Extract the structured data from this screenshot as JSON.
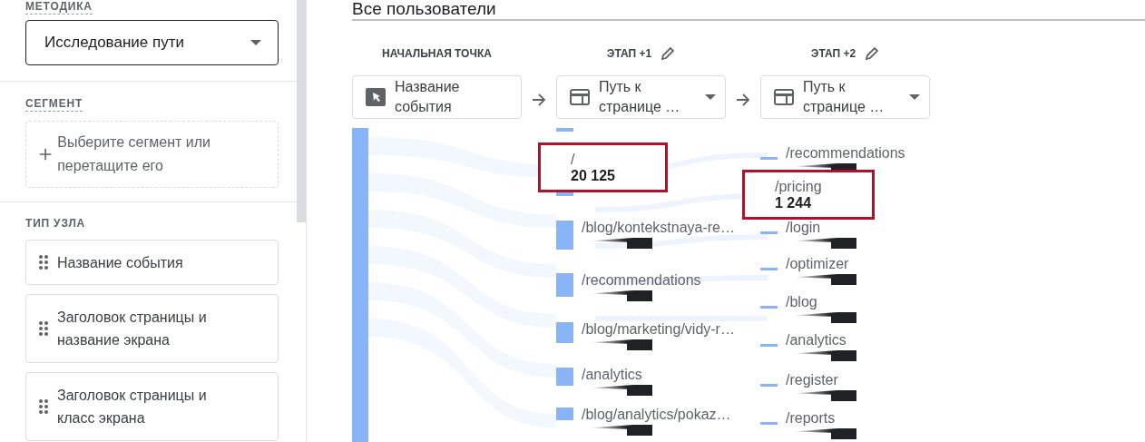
{
  "sidebar": {
    "technique": {
      "label": "МЕТОДИКА",
      "value": "Исследование пути"
    },
    "segment": {
      "label": "СЕГМЕНТ",
      "placeholder": "Выберите сегмент или перетащите его"
    },
    "node_type": {
      "label": "ТИП УЗЛА",
      "items": [
        "Название события",
        "Заголовок страницы и название экрана",
        "Заголовок страницы и класс экрана"
      ]
    }
  },
  "main": {
    "title": "Все пользователи",
    "steps": [
      {
        "header": "НАЧАЛЬНАЯ ТОЧКА",
        "editable": false,
        "kind": "event",
        "value": "Название события",
        "dropdown": false
      },
      {
        "header": "ЭТАП +1",
        "editable": true,
        "kind": "page",
        "value": "Путь к странице …",
        "dropdown": true
      },
      {
        "header": "ЭТАП +2",
        "editable": true,
        "kind": "page",
        "value": "Путь к странице …",
        "dropdown": true
      }
    ],
    "step_1_nodes": [
      {
        "label": "/",
        "value": "20 125",
        "highlighted": true
      },
      {
        "label": "/blog/kontekstnaya-re…",
        "highlighted": false
      },
      {
        "label": "/recommendations",
        "highlighted": false
      },
      {
        "label": "/blog/marketing/vidy-r…",
        "highlighted": false
      },
      {
        "label": "/analytics",
        "highlighted": false
      },
      {
        "label": "/blog/analytics/pokaz…",
        "highlighted": false
      }
    ],
    "step_2_nodes": [
      {
        "label": "/recommendations",
        "highlighted": false
      },
      {
        "label": "/pricing",
        "value": "1 244",
        "highlighted": true
      },
      {
        "label": "/login",
        "highlighted": false
      },
      {
        "label": "/optimizer",
        "highlighted": false
      },
      {
        "label": "/blog",
        "highlighted": false
      },
      {
        "label": "/analytics",
        "highlighted": false
      },
      {
        "label": "/register",
        "highlighted": false
      },
      {
        "label": "/reports",
        "highlighted": false
      }
    ]
  }
}
